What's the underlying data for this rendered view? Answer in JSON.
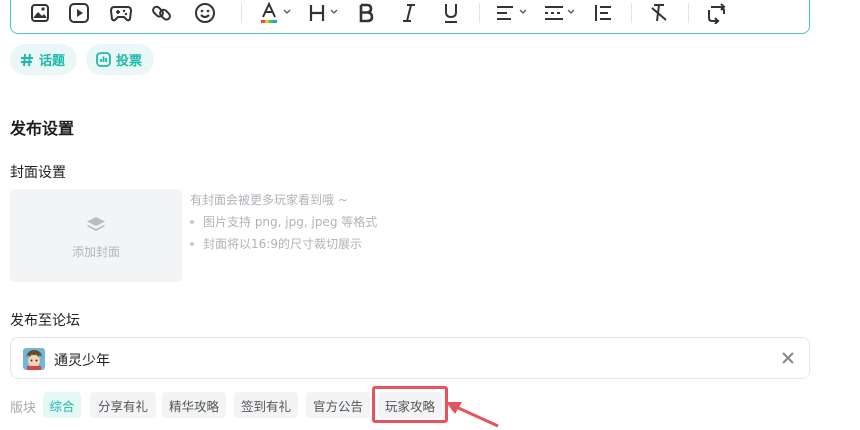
{
  "toolbar": {
    "icons": [
      "image-icon",
      "video-icon",
      "gamepad-icon",
      "link-icon",
      "emoji-icon",
      "font-color-icon",
      "heading-icon",
      "bold-icon",
      "italic-icon",
      "underline-icon",
      "align-icon",
      "divider-line-icon",
      "list-icon",
      "clear-format-icon",
      "redo-icon"
    ],
    "accent": "#3fc9bb"
  },
  "pills": {
    "topic_label": "话题",
    "vote_label": "投票"
  },
  "publish": {
    "section_title": "发布设置",
    "cover_label": "封面设置",
    "cover_add": "添加封面",
    "cover_hint_head": "有封面会被更多玩家看到哦 ~",
    "cover_hints": [
      "图片支持 png, jpg, jpeg 等格式",
      "封面将以16:9的尺寸裁切展示"
    ],
    "forum_label": "发布至论坛",
    "forum_name": "通灵少年",
    "section_label": "版块",
    "tags": [
      "综合",
      "分享有礼",
      "精华攻略",
      "签到有礼",
      "官方公告",
      "玩家攻略"
    ],
    "active_tag": "综合",
    "highlighted_tag": "玩家攻略"
  },
  "colors": {
    "accent": "#1eb9a8",
    "highlight": "#e8515e"
  }
}
